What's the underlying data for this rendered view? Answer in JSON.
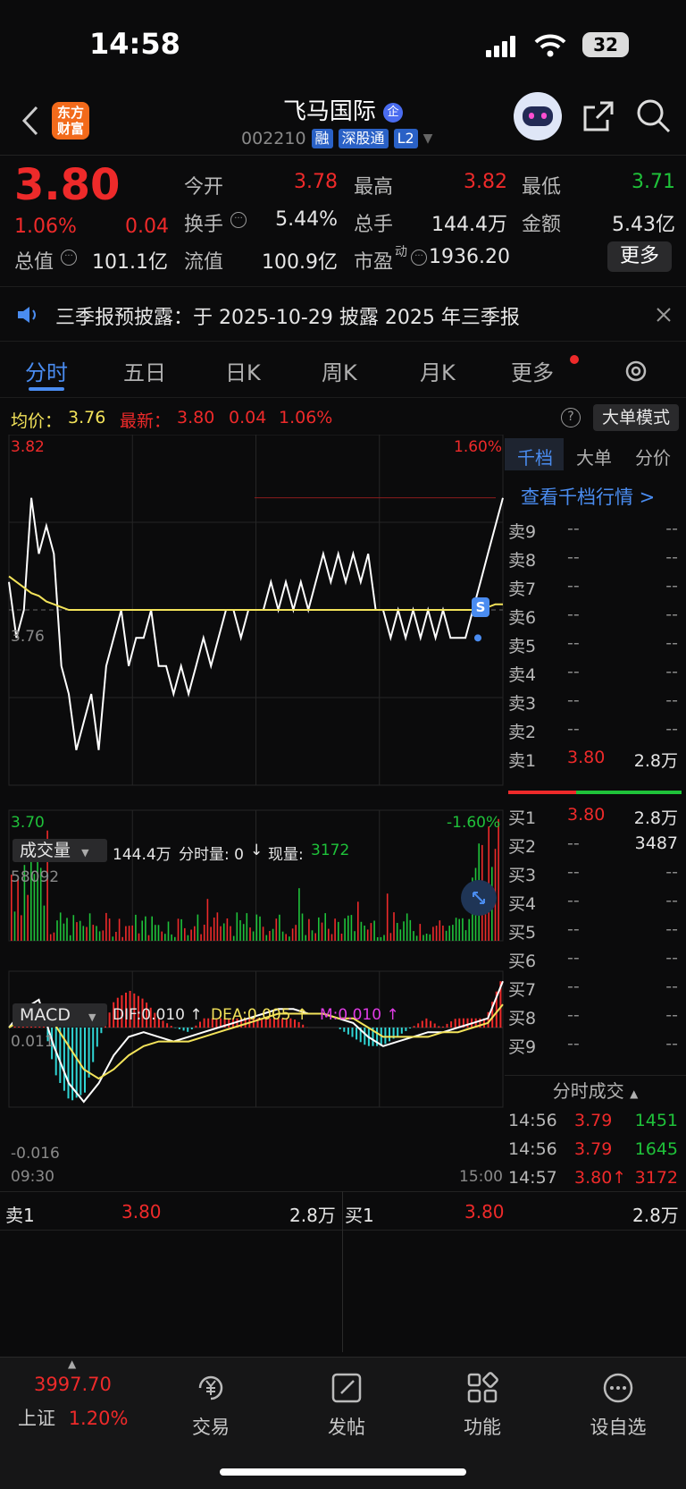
{
  "status_bar": {
    "time": "14:58",
    "battery": "32"
  },
  "header": {
    "stock_name": "飞马国际",
    "badge": "企",
    "code": "002210",
    "tags": [
      "融",
      "深股通",
      "L2"
    ],
    "logo_text": [
      "东方",
      "财富"
    ]
  },
  "quote": {
    "price": "3.80",
    "change_pct": "1.06%",
    "change": "0.04",
    "fields": [
      {
        "label": "今开",
        "value": "3.78",
        "color": "red"
      },
      {
        "label": "最高",
        "value": "3.82",
        "color": "red"
      },
      {
        "label": "最低",
        "value": "3.71",
        "color": "green"
      },
      {
        "label": "换手",
        "value": "5.44%",
        "color": "white"
      },
      {
        "label": "总手",
        "value": "144.4万",
        "color": "white"
      },
      {
        "label": "金额",
        "value": "5.43亿",
        "color": "white"
      },
      {
        "label": "总值",
        "value": "101.1亿",
        "color": "white"
      },
      {
        "label": "流值",
        "value": "100.9亿",
        "color": "white"
      },
      {
        "label": "市盈",
        "value": "1936.20",
        "color": "white"
      }
    ],
    "pe_superscript": "动",
    "more_button": "更多"
  },
  "notice": {
    "text": "三季报预披露：于 2025-10-29 披露 2025 年三季报"
  },
  "tabs": [
    "分时",
    "五日",
    "日K",
    "周K",
    "月K",
    "更多"
  ],
  "avg_line": {
    "avg_label": "均价：",
    "avg_value": "3.76",
    "latest_label": "最新：",
    "latest_value": "3.80",
    "latest_change": "0.04",
    "latest_pct": "1.06%",
    "big_order_button": "大单模式"
  },
  "chart_data": {
    "type": "line",
    "price_axis": {
      "max": "3.82",
      "mid": "3.76",
      "min": "3.70",
      "max_pct": "1.60%",
      "min_pct": "-1.60%"
    },
    "time_axis": [
      "09:30",
      "15:00"
    ],
    "prev_close": 3.76,
    "price_series": [
      3.77,
      3.75,
      3.76,
      3.8,
      3.78,
      3.79,
      3.78,
      3.74,
      3.73,
      3.71,
      3.72,
      3.73,
      3.71,
      3.74,
      3.75,
      3.76,
      3.74,
      3.75,
      3.75,
      3.76,
      3.74,
      3.74,
      3.73,
      3.74,
      3.73,
      3.74,
      3.75,
      3.74,
      3.75,
      3.76,
      3.76,
      3.75,
      3.76,
      3.76,
      3.76,
      3.77,
      3.76,
      3.77,
      3.76,
      3.77,
      3.76,
      3.77,
      3.78,
      3.77,
      3.78,
      3.77,
      3.78,
      3.77,
      3.78,
      3.76,
      3.76,
      3.75,
      3.76,
      3.75,
      3.76,
      3.75,
      3.76,
      3.75,
      3.76,
      3.75,
      3.75,
      3.75,
      3.76,
      3.77,
      3.78,
      3.79,
      3.8
    ],
    "avg_series": [
      3.772,
      3.77,
      3.768,
      3.766,
      3.765,
      3.763,
      3.762,
      3.761,
      3.76,
      3.76,
      3.76,
      3.76,
      3.76,
      3.76,
      3.76,
      3.76,
      3.76,
      3.76,
      3.76,
      3.76,
      3.76,
      3.76,
      3.76,
      3.76,
      3.76,
      3.76,
      3.76,
      3.76,
      3.76,
      3.76,
      3.76,
      3.76,
      3.76,
      3.76,
      3.76,
      3.76,
      3.76,
      3.76,
      3.76,
      3.76,
      3.76,
      3.76,
      3.76,
      3.76,
      3.76,
      3.76,
      3.76,
      3.76,
      3.76,
      3.76,
      3.76,
      3.76,
      3.76,
      3.76,
      3.76,
      3.76,
      3.76,
      3.76,
      3.76,
      3.76,
      3.76,
      3.76,
      3.76,
      3.761,
      3.761,
      3.762,
      3.762
    ],
    "volume": {
      "label": "成交量",
      "total": "144.4万",
      "tick_label": "分时量: 0",
      "current_label": "现量:",
      "current_value": "3172",
      "max": "58092"
    },
    "macd": {
      "label": "MACD",
      "dif": "DIF:0.010 ↑",
      "dea": "DEA:0.005 ↑",
      "m": "M:0.010 ↑",
      "max": "0.011",
      "min": "-0.016",
      "dif_series": [
        0.0,
        0.004,
        0.006,
        -0.004,
        -0.012,
        -0.016,
        -0.012,
        -0.006,
        -0.002,
        -0.001,
        -0.002,
        -0.003,
        -0.002,
        -0.001,
        0.0,
        0.001,
        0.002,
        0.003,
        0.004,
        0.004,
        0.003,
        0.003,
        0.002,
        0.001,
        -0.002,
        -0.004,
        -0.003,
        -0.002,
        -0.001,
        -0.001,
        0.0,
        0.001,
        0.002,
        0.01
      ],
      "dea_series": [
        0.0,
        0.002,
        0.004,
        0.001,
        -0.004,
        -0.009,
        -0.011,
        -0.009,
        -0.006,
        -0.004,
        -0.003,
        -0.003,
        -0.003,
        -0.002,
        -0.001,
        0.0,
        0.001,
        0.002,
        0.003,
        0.003,
        0.003,
        0.003,
        0.002,
        0.002,
        0.0,
        -0.002,
        -0.002,
        -0.002,
        -0.002,
        -0.001,
        -0.001,
        0.0,
        0.001,
        0.005
      ],
      "m_series": [
        0.0,
        0.004,
        0.004,
        -0.01,
        -0.016,
        -0.014,
        -0.002,
        0.006,
        0.008,
        0.006,
        0.002,
        0.0,
        -0.001,
        0.002,
        0.002,
        0.002,
        0.002,
        0.002,
        0.002,
        0.002,
        0.0,
        0.0,
        0.0,
        -0.002,
        -0.004,
        -0.004,
        -0.002,
        0.0,
        0.002,
        0.0,
        0.002,
        0.002,
        0.002,
        0.01
      ]
    }
  },
  "side_panel": {
    "tabs": [
      "千档",
      "大单",
      "分价"
    ],
    "link": "查看千档行情 >",
    "sells": [
      {
        "label": "卖9",
        "price": "--",
        "vol": "--"
      },
      {
        "label": "卖8",
        "price": "--",
        "vol": "--"
      },
      {
        "label": "卖7",
        "price": "--",
        "vol": "--"
      },
      {
        "label": "卖6",
        "price": "--",
        "vol": "--"
      },
      {
        "label": "卖5",
        "price": "--",
        "vol": "--"
      },
      {
        "label": "卖4",
        "price": "--",
        "vol": "--"
      },
      {
        "label": "卖3",
        "price": "--",
        "vol": "--"
      },
      {
        "label": "卖2",
        "price": "--",
        "vol": "--"
      },
      {
        "label": "卖1",
        "price": "3.80",
        "vol": "2.8万"
      }
    ],
    "buys": [
      {
        "label": "买1",
        "price": "3.80",
        "vol": "2.8万"
      },
      {
        "label": "买2",
        "price": "--",
        "vol": "3487"
      },
      {
        "label": "买3",
        "price": "--",
        "vol": "--"
      },
      {
        "label": "买4",
        "price": "--",
        "vol": "--"
      },
      {
        "label": "买5",
        "price": "--",
        "vol": "--"
      },
      {
        "label": "买6",
        "price": "--",
        "vol": "--"
      },
      {
        "label": "买7",
        "price": "--",
        "vol": "--"
      },
      {
        "label": "买8",
        "price": "--",
        "vol": "--"
      },
      {
        "label": "买9",
        "price": "--",
        "vol": "--"
      }
    ],
    "trades_title": "分时成交",
    "trades": [
      {
        "time": "14:56",
        "price": "3.79",
        "vol": "1451",
        "vol_color": "green"
      },
      {
        "time": "14:56",
        "price": "3.79",
        "vol": "1645",
        "vol_color": "green"
      },
      {
        "time": "14:57",
        "price": "3.80↑",
        "vol": "3172",
        "vol_color": "red"
      }
    ]
  },
  "bid_bar": {
    "sell_label": "卖1",
    "sell_price": "3.80",
    "sell_vol": "2.8万",
    "buy_label": "买1",
    "buy_price": "3.80",
    "buy_vol": "2.8万"
  },
  "nav": {
    "index_value": "3997.70",
    "index_name": "上证",
    "index_pct": "1.20%",
    "items": [
      "交易",
      "发帖",
      "功能",
      "设自选"
    ]
  },
  "colors": {
    "up": "#ee2a2a",
    "down": "#1fc23a",
    "accent": "#4a8cf0",
    "avg": "#f3e35a"
  }
}
